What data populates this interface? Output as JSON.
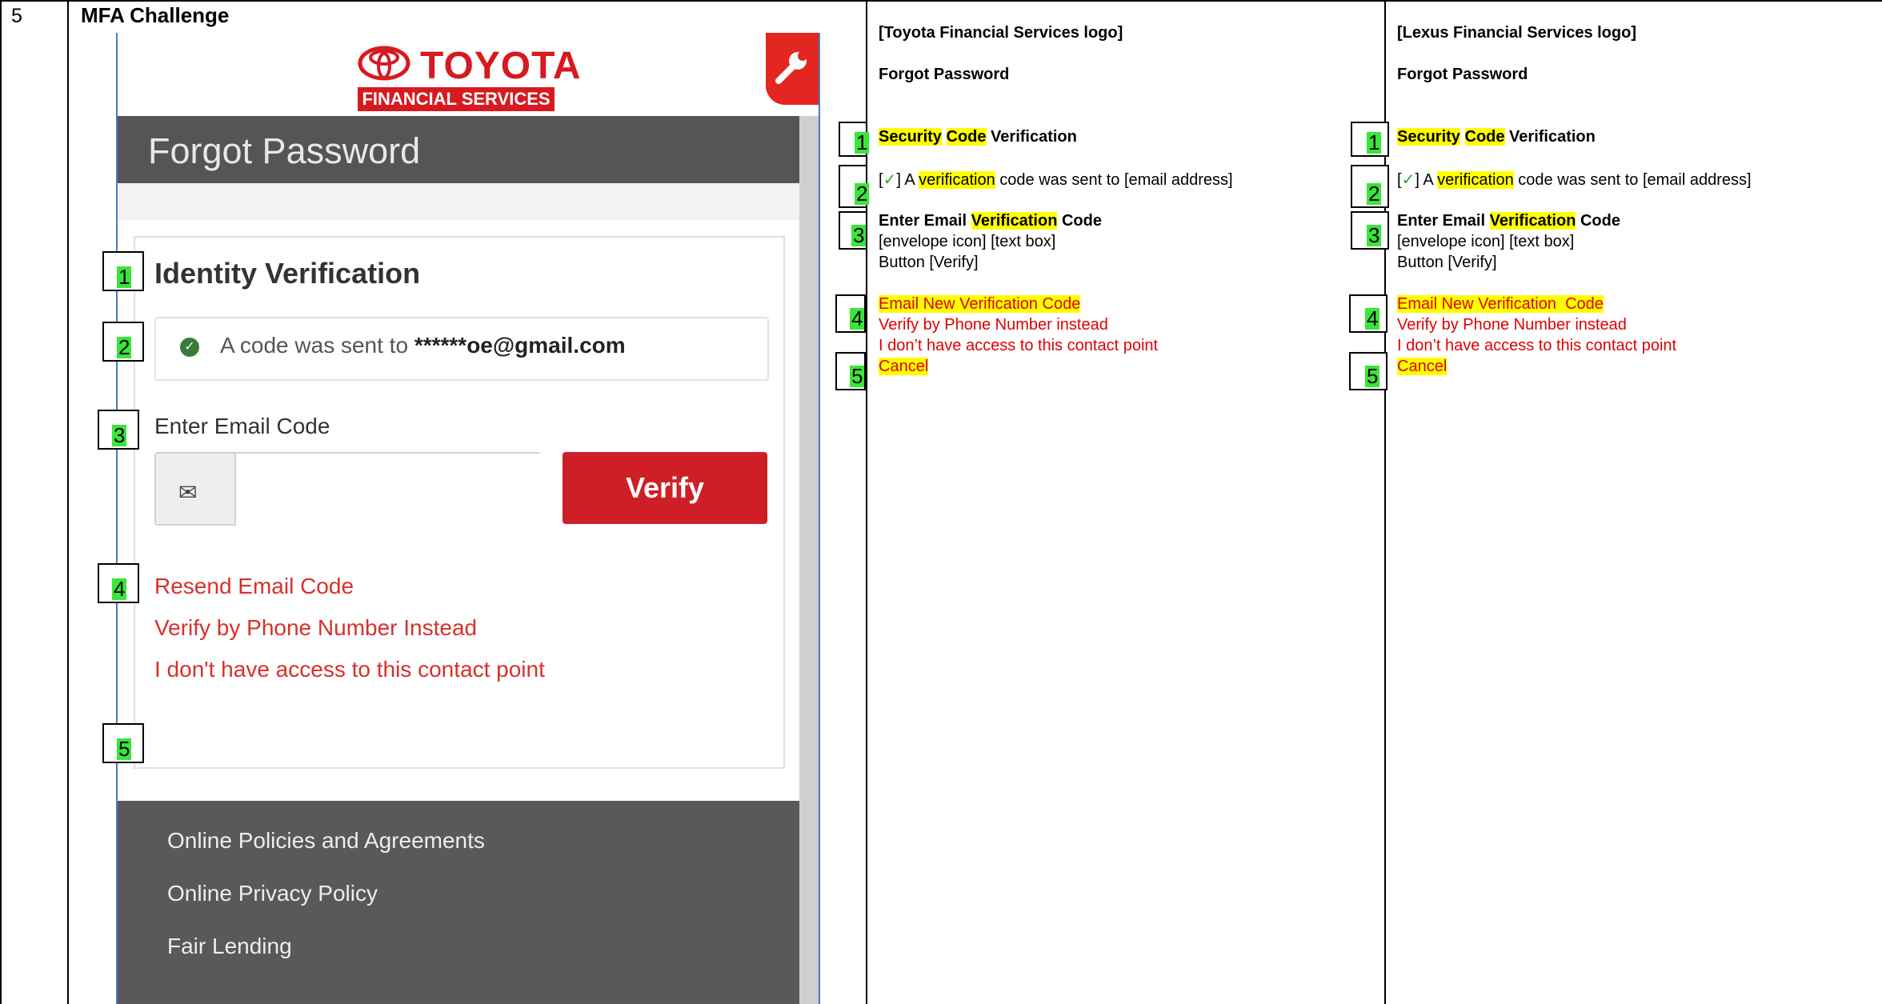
{
  "row": {
    "number": "5",
    "title": "MFA Challenge"
  },
  "screenshot": {
    "logo": {
      "brand": "TOYOTA",
      "subtitle": "FINANCIAL SERVICES"
    },
    "banner_title": "Forgot Password",
    "card_title": "Identity Verification",
    "alert": {
      "prefix": "A code was sent to ",
      "email": "******oe@gmail.com"
    },
    "enter_label": "Enter Email Code",
    "verify_label": "Verify",
    "links": [
      "Resend Email Code",
      "Verify by Phone Number Instead",
      "I don't have access to this contact point"
    ],
    "footer_links": [
      "Online Policies and Agreements",
      "Online Privacy Policy",
      "Fair Lending"
    ],
    "icons": [
      "toyota-emblem-icon",
      "wrench-icon",
      "check-icon",
      "envelope-icon"
    ],
    "colors": {
      "brand_red": "#d71920",
      "banner": "#555555",
      "link_red": "#d9302b"
    }
  },
  "callouts": [
    "1",
    "2",
    "3",
    "4",
    "5"
  ],
  "toyota_spec": {
    "logo": "[Toyota Financial Services logo]",
    "page_title": "Forgot Password",
    "section_title": {
      "a": "Security",
      "b": " ",
      "c": "Code",
      "d": " Verification"
    },
    "sent_line": {
      "open": "[",
      "check": "✓",
      "close": "] A ",
      "hl": "verification",
      "rest": " code was sent to [email address]"
    },
    "enter": {
      "a": "Enter Email ",
      "hl": "Verification",
      "b": " Code"
    },
    "icons_line": "[envelope icon] [text box]",
    "button_line": "Button [Verify]",
    "link1": "Email New Verification Code",
    "link2": "Verify by Phone Number instead",
    "link3": "I don’t have access to this contact point",
    "link4": "Cancel"
  },
  "lexus_spec": {
    "logo": "[Lexus Financial Services logo]",
    "page_title": "Forgot Password",
    "section_title": {
      "a": "Security",
      "b": " ",
      "c": "Code",
      "d": " Verification"
    },
    "sent_line": {
      "open": "[",
      "check": "✓",
      "close": "] A ",
      "hl": "verification",
      "rest": " code was sent to [email address]"
    },
    "enter": {
      "a": "Enter Email ",
      "hl": "Verification",
      "b": " Code"
    },
    "icons_line": "[envelope icon] [text box]",
    "button_line": "Button [Verify]",
    "link1": "Email New Verification  Code",
    "link2": "Verify by Phone Number instead",
    "link3": "I don’t have access to this contact point",
    "link4": "Cancel"
  }
}
